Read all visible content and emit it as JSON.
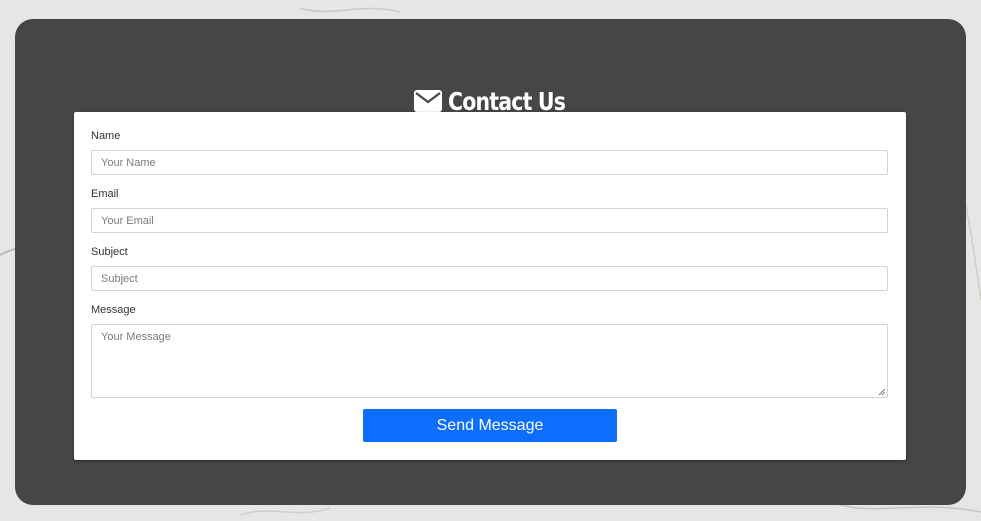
{
  "page": {
    "title": "Contact Us",
    "title_icon": "envelope-icon"
  },
  "form": {
    "name": {
      "label": "Name",
      "placeholder": "Your Name"
    },
    "email": {
      "label": "Email",
      "placeholder": "Your Email"
    },
    "subject": {
      "label": "Subject",
      "placeholder": "Subject"
    },
    "message": {
      "label": "Message",
      "placeholder": "Your Message"
    },
    "submit_label": "Send Message"
  },
  "colors": {
    "panel": "#464646",
    "button": "#0d6efd",
    "card": "#ffffff"
  }
}
